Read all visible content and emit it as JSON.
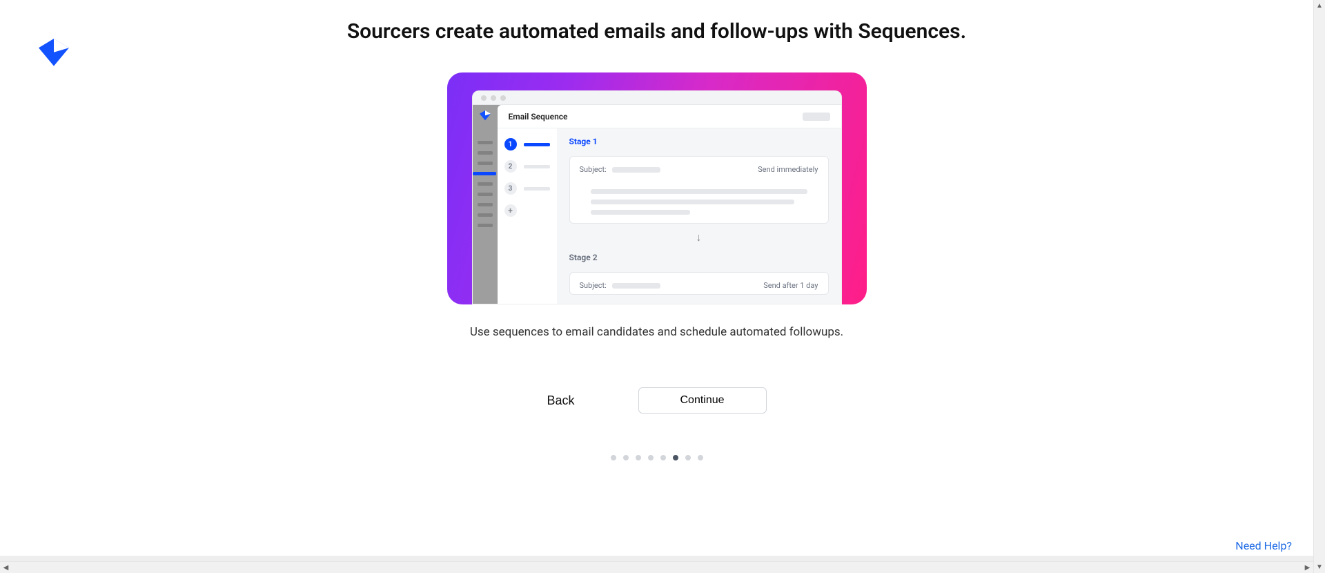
{
  "heading": "Sourcers create automated emails and follow-ups with Sequences.",
  "caption": "Use sequences to email candidates and schedule automated followups.",
  "buttons": {
    "back": "Back",
    "continue": "Continue"
  },
  "help_link": "Need Help?",
  "pagination": {
    "total": 8,
    "active_index": 5
  },
  "illustration": {
    "panel_title": "Email Sequence",
    "steps": [
      {
        "label": "1",
        "active": true
      },
      {
        "label": "2",
        "active": false
      },
      {
        "label": "3",
        "active": false
      }
    ],
    "add_icon": "+",
    "stage1": {
      "title": "Stage 1",
      "subject_label": "Subject:",
      "send_note": "Send immediately"
    },
    "stage2": {
      "title": "Stage 2",
      "subject_label": "Subject:",
      "send_note": "Send after 1 day"
    },
    "arrow_glyph": "↓"
  }
}
